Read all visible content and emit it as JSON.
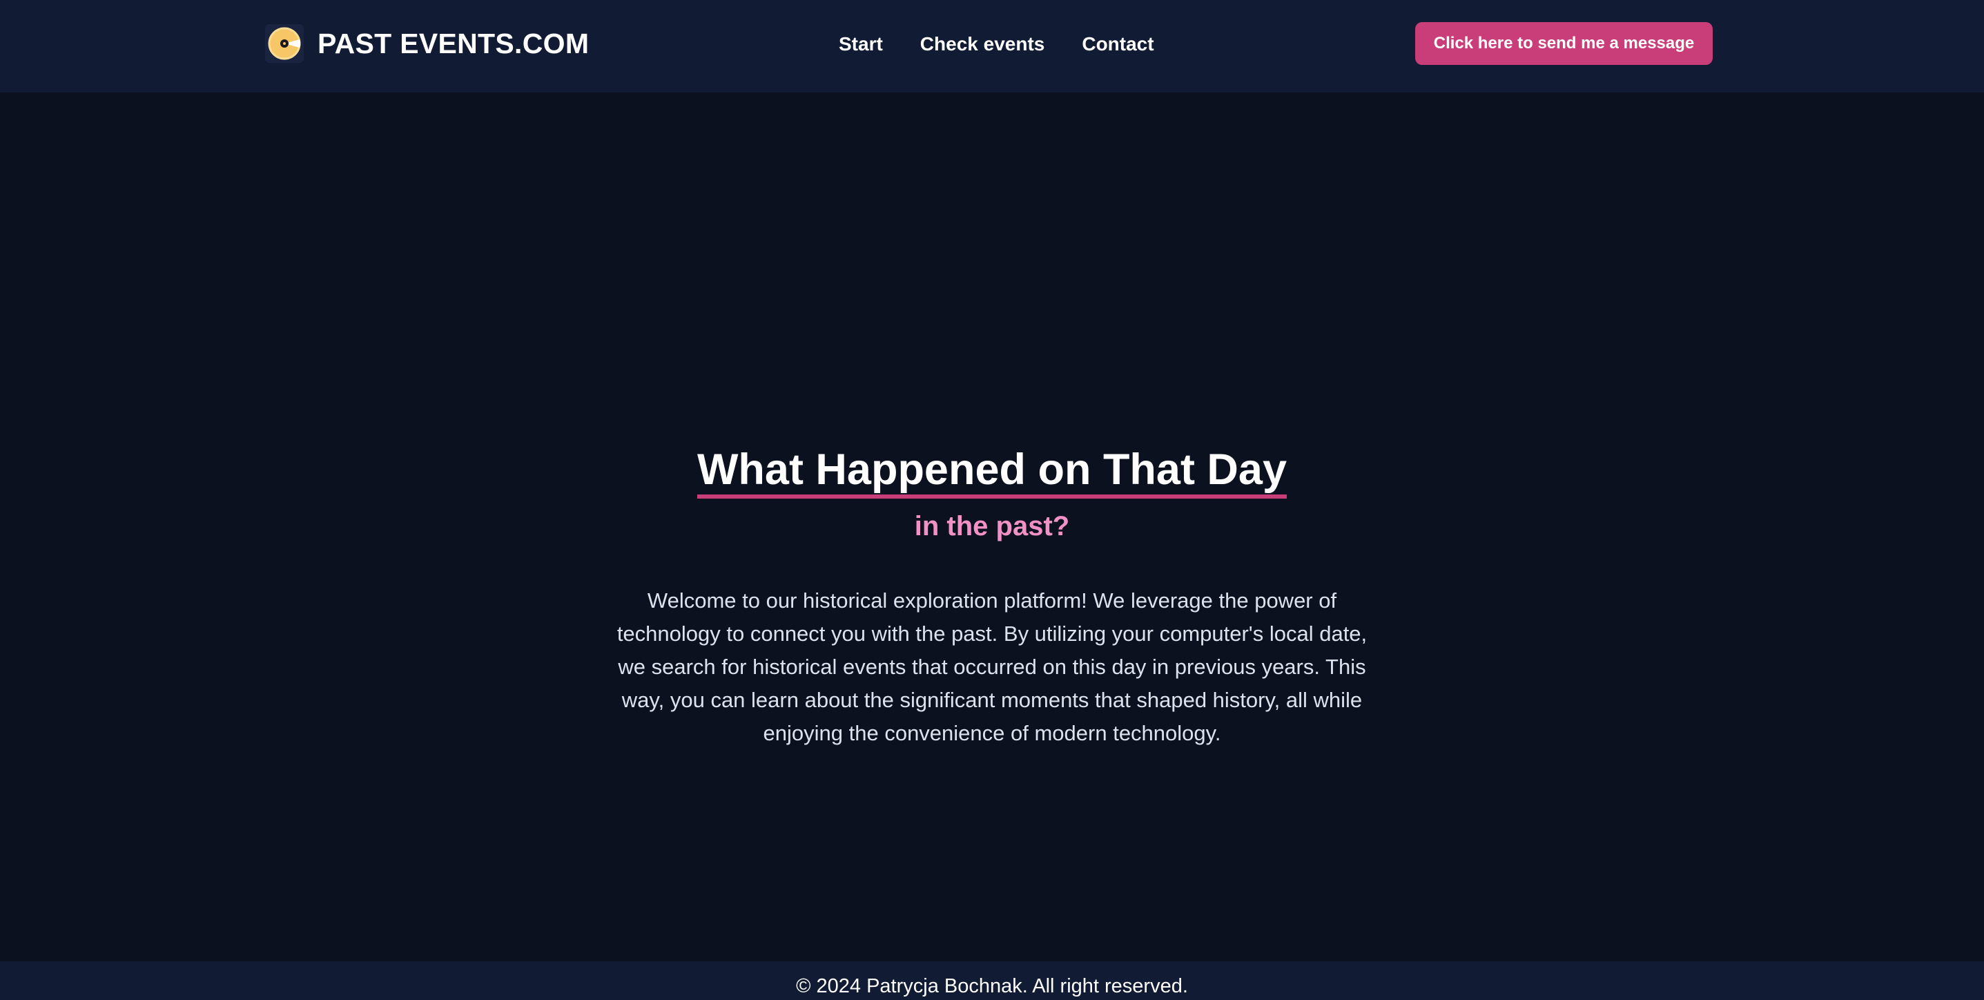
{
  "header": {
    "brand": "PAST EVENTS.COM",
    "logo_icon": "disc-icon",
    "nav": [
      {
        "label": "Start"
      },
      {
        "label": "Check events"
      },
      {
        "label": "Contact"
      }
    ],
    "cta_label": "Click here to send me a message"
  },
  "hero": {
    "title": "What Happened on That Day",
    "subtitle": "in the past?",
    "description": "Welcome to our historical exploration platform! We leverage the power of technology to connect you with the past. By utilizing your computer's local date, we search for historical events that occurred on this day in previous years. This way, you can learn about the significant moments that shaped history, all while enjoying the convenience of modern technology."
  },
  "footer": {
    "copyright": "© 2024 Patrycja Bochnak. All right reserved."
  },
  "colors": {
    "background": "#0b111f",
    "header_bg": "#111b33",
    "accent": "#c93d79",
    "subtitle": "#f291c6",
    "text": "#dde2ec"
  }
}
